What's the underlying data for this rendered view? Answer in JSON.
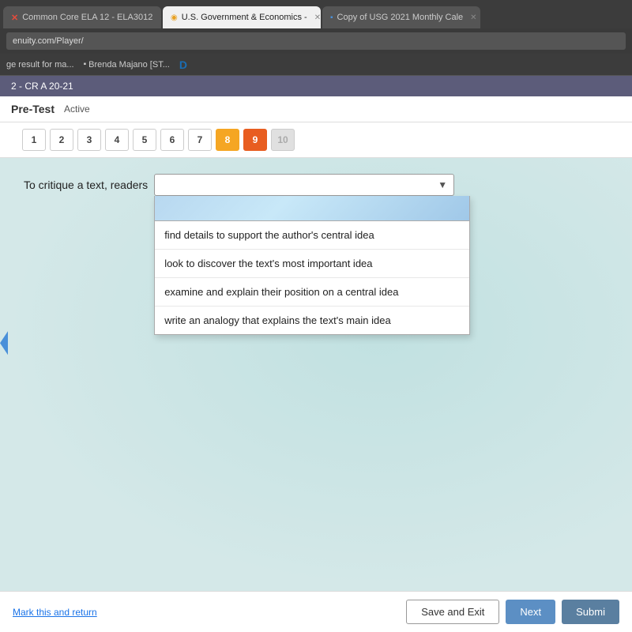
{
  "browser": {
    "tabs": [
      {
        "id": "tab1",
        "icon_type": "x",
        "label": "Common Core ELA 12 - ELA3012",
        "active": false
      },
      {
        "id": "tab2",
        "icon_type": "circle",
        "label": "U.S. Government & Economics -",
        "active": true
      },
      {
        "id": "tab3",
        "icon_type": "doc",
        "label": "Copy of USG 2021 Monthly Cale",
        "active": false
      }
    ],
    "address": "enuity.com/Player/",
    "bookmarks": [
      {
        "label": "ge result for ma..."
      },
      {
        "icon": "doc",
        "label": "Brenda Majano [ST..."
      },
      {
        "icon": "disney",
        "label": ""
      }
    ]
  },
  "page": {
    "breadcrumb": "2 - CR A 20-21",
    "section_label": "Pre-Test",
    "status": "Active",
    "nav_buttons": [
      {
        "num": "1",
        "state": "normal"
      },
      {
        "num": "2",
        "state": "normal"
      },
      {
        "num": "3",
        "state": "normal"
      },
      {
        "num": "4",
        "state": "normal"
      },
      {
        "num": "5",
        "state": "normal"
      },
      {
        "num": "6",
        "state": "normal"
      },
      {
        "num": "7",
        "state": "normal"
      },
      {
        "num": "8",
        "state": "answered"
      },
      {
        "num": "9",
        "state": "current"
      },
      {
        "num": "10",
        "state": "disabled"
      }
    ],
    "question_prefix": "To critique a text, readers",
    "dropdown": {
      "placeholder": "",
      "options": [
        "find details to support the author's central idea",
        "look to discover the text's most important idea",
        "examine and explain their position on a central idea",
        "write an analogy that explains the text's main idea"
      ]
    },
    "bottom": {
      "mark_return": "Mark this and return",
      "save_exit": "Save and Exit",
      "next": "Next",
      "submit": "Submi"
    }
  }
}
